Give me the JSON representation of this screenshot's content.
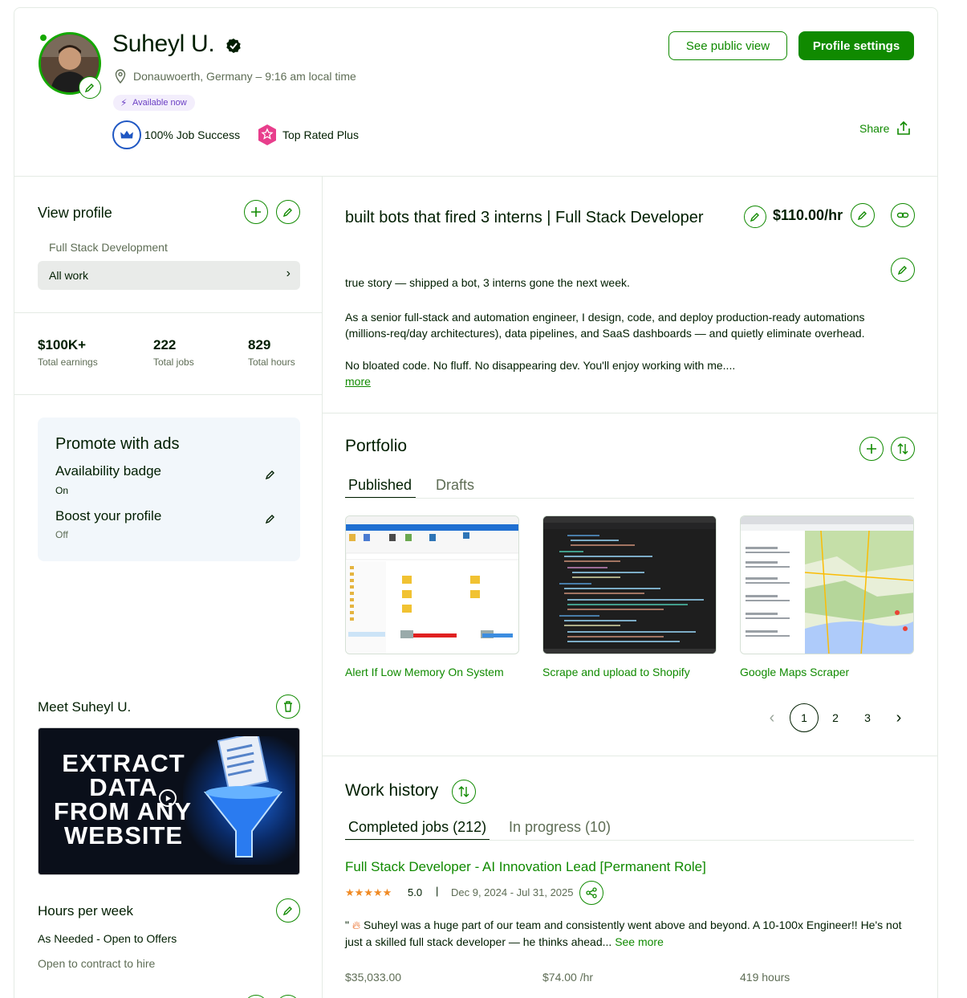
{
  "header": {
    "name": "Suheyl U.",
    "location": "Donauwoerth, Germany – 9:16 am local time",
    "available_badge": "Available now",
    "job_success": "100% Job Success",
    "top_rated": "Top Rated Plus",
    "see_public_view": "See public view",
    "profile_settings": "Profile settings",
    "share": "Share"
  },
  "sidebar": {
    "view_profile_title": "View profile",
    "specialization": "Full Stack Development",
    "all_work": "All work",
    "stats": [
      {
        "value": "$100K+",
        "label": "Total earnings"
      },
      {
        "value": "222",
        "label": "Total jobs"
      },
      {
        "value": "829",
        "label": "Total hours"
      }
    ],
    "promote": {
      "title": "Promote with ads",
      "availability_label": "Availability badge",
      "availability_value": "On",
      "boost_label": "Boost your profile",
      "boost_value": "Off"
    },
    "meet_title": "Meet Suheyl U.",
    "video_text_line1": "EXTRACT",
    "video_text_line2": "DATA",
    "video_text_line3": "FROM ANY",
    "video_text_line4": "WEBSITE",
    "hours_title": "Hours per week",
    "hours_value": "As Needed - Open to Offers",
    "contract_to_hire": "Open to contract to hire"
  },
  "main": {
    "headline": "built bots that fired 3 interns | Full Stack Developer",
    "rate": "$110.00/hr",
    "bio_line1": "true story — shipped a bot, 3 interns gone the next week.",
    "bio_line2": "As a senior full-stack and automation engineer, I design, code, and deploy production-ready automations (millions-req/day architectures), data pipelines, and SaaS dashboards — and quietly eliminate overhead.",
    "bio_line3": "No bloated code. No fluff. No disappearing dev. You'll enjoy working with me....",
    "more": "more",
    "portfolio": {
      "title": "Portfolio",
      "tabs": [
        "Published",
        "Drafts"
      ],
      "items": [
        {
          "title": "Alert If Low Memory On System"
        },
        {
          "title": "Scrape and upload to Shopify"
        },
        {
          "title": "Google Maps Scraper"
        }
      ],
      "pages": [
        "1",
        "2",
        "3"
      ]
    },
    "work_history": {
      "title": "Work history",
      "tabs": [
        "Completed jobs (212)",
        "In progress (10)"
      ],
      "job_title": "Full Stack Developer - AI Innovation Lead [Permanent Role]",
      "rating": "5.0",
      "dates": "Dec 9, 2024 - Jul 31, 2025",
      "quote_open": "\"",
      "review": "Suheyl was a huge part of our team and consistently went above and beyond. A 10-100x Engineer!! He's not just a skilled full stack developer — he thinks ahead...",
      "see_more": "See more",
      "earned": "$35,033.00",
      "hourly": "$74.00 /hr",
      "hours": "419 hours"
    }
  },
  "colors": {
    "brand_green": "#108a00",
    "text": "#001e00",
    "muted": "#5e6d55",
    "available_purple": "#6b3fc4",
    "top_rated_pink": "#e83e8c",
    "star_orange": "#f08a24"
  }
}
